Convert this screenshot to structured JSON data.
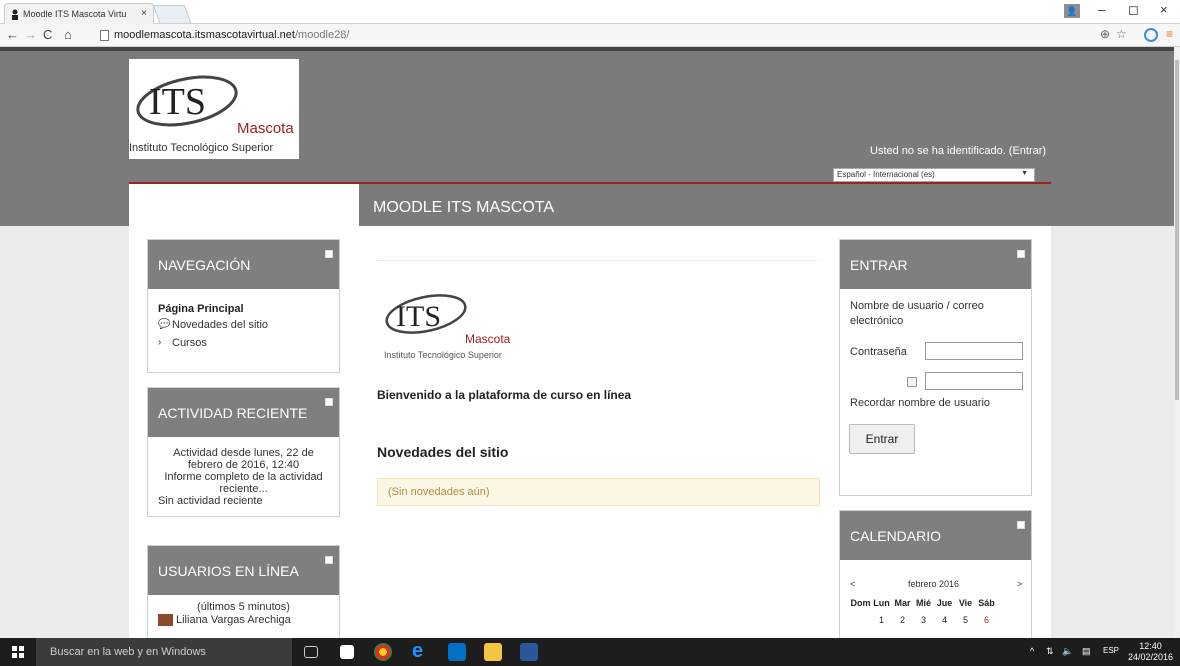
{
  "browser": {
    "tab_title": "Moodle ITS Mascota Virtu",
    "tab_close": "×",
    "url_host": "moodlemascota.itsmascotavirtual.net",
    "url_path": "/moodle28/"
  },
  "window_controls": {
    "minimize": "–",
    "maximize": "◻",
    "close": "×"
  },
  "header": {
    "logo": {
      "initials": "ITS",
      "name": "Mascota",
      "subtitle": "Instituto Tecnológico Superior"
    },
    "login_info": "Usted no se ha identificado. (Entrar)",
    "language": "Español - Internacional (es)",
    "site_title": "MOODLE ITS MASCOTA"
  },
  "navigation": {
    "title": "NAVEGACIÓN",
    "home": "Página Principal",
    "items": [
      {
        "label": "Novedades del sitio",
        "icon": "speech-bubble-icon"
      },
      {
        "label": "Cursos",
        "icon": "chevron-right-icon"
      }
    ]
  },
  "recent_activity": {
    "title": "ACTIVIDAD RECIENTE",
    "since": "Actividad desde lunes, 22 de febrero de 2016, 12:40",
    "full_report": "Informe completo de la actividad reciente...",
    "none": "Sin actividad reciente"
  },
  "online_users": {
    "title": "USUARIOS EN LÍNEA",
    "period": "(últimos 5 minutos)",
    "users": [
      "Liliana Vargas Arechiga"
    ]
  },
  "main": {
    "welcome": "Bienvenido a la plataforma de curso en línea",
    "news_heading": "Novedades del sitio",
    "no_news": "(Sin novedades aún)"
  },
  "login_block": {
    "title": "ENTRAR",
    "username_label": "Nombre de usuario / correo electrónico",
    "password_label": "Contraseña",
    "remember_label": "Recordar nombre de usuario",
    "submit": "Entrar"
  },
  "calendar": {
    "title": "CALENDARIO",
    "prev": "<",
    "next": ">",
    "month": "febrero 2016",
    "weekdays": [
      "Dom",
      "Lun",
      "Mar",
      "Mié",
      "Jue",
      "Vie",
      "Sáb"
    ],
    "first_week": [
      "",
      "1",
      "2",
      "3",
      "4",
      "5",
      "6"
    ],
    "weekend_color": "#b0212a"
  },
  "taskbar": {
    "search_placeholder": "Buscar en la web y en Windows",
    "language": "ESP",
    "time": "12:40",
    "date": "24/02/2016"
  },
  "colors": {
    "header_gray": "#7b7b7b",
    "accent_red": "#9e1f25",
    "block_head": "#7f7f7f"
  }
}
